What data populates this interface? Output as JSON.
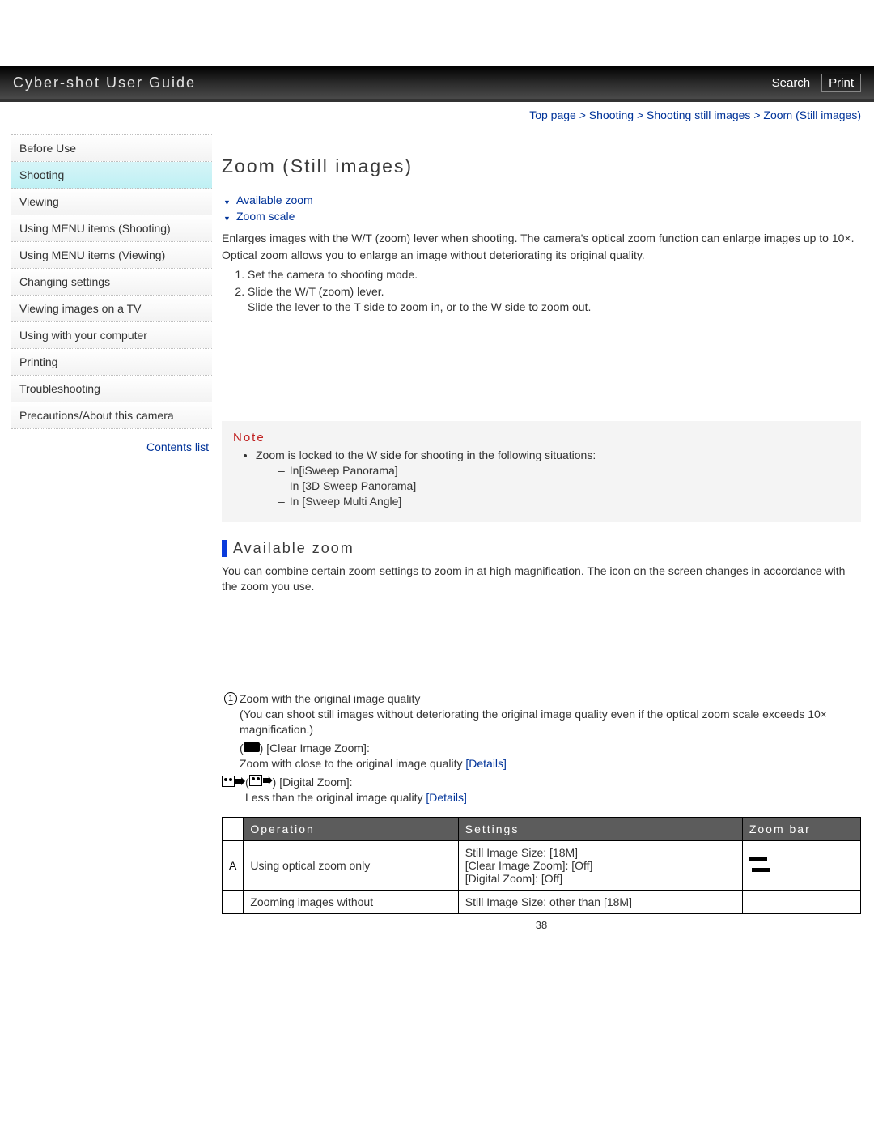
{
  "header": {
    "title": "Cyber-shot User Guide",
    "search_label": "Search",
    "print_label": "Print"
  },
  "breadcrumb": {
    "items": [
      "Top page",
      "Shooting",
      "Shooting still images",
      "Zoom (Still images)"
    ]
  },
  "sidebar": {
    "items": [
      {
        "label": "Before Use",
        "active": false
      },
      {
        "label": "Shooting",
        "active": true
      },
      {
        "label": "Viewing",
        "active": false
      },
      {
        "label": "Using MENU items (Shooting)",
        "active": false
      },
      {
        "label": "Using MENU items (Viewing)",
        "active": false
      },
      {
        "label": "Changing settings",
        "active": false
      },
      {
        "label": "Viewing images on a TV",
        "active": false
      },
      {
        "label": "Using with your computer",
        "active": false
      },
      {
        "label": "Printing",
        "active": false
      },
      {
        "label": "Troubleshooting",
        "active": false
      },
      {
        "label": "Precautions/About this camera",
        "active": false
      }
    ],
    "contents_list_label": "Contents list"
  },
  "page": {
    "title": "Zoom (Still images)",
    "anchor_links": [
      "Available zoom",
      "Zoom scale"
    ],
    "intro_paragraphs": [
      "Enlarges images with the W/T (zoom) lever when shooting. The camera's optical zoom function can enlarge images up to 10×.",
      "Optical zoom allows you to enlarge an image without deteriorating its original quality."
    ],
    "steps": [
      {
        "text": "Set the camera to shooting mode."
      },
      {
        "text": "Slide the W/T (zoom) lever.",
        "sub": "Slide the lever to the T side to zoom in, or to the W side to zoom out."
      }
    ],
    "note": {
      "heading": "Note",
      "lead": "Zoom is locked to the W side for shooting in the following situations:",
      "sub_items": [
        "In[iSweep Panorama]",
        "In [3D Sweep Panorama]",
        "In [Sweep Multi Angle]"
      ]
    },
    "available_zoom": {
      "heading": "Available zoom",
      "intro": "You can combine certain zoom settings to zoom in at high magnification. The icon on the screen changes in accordance with the zoom you use.",
      "items": [
        {
          "icon": "circled-one-icon",
          "title": "Zoom with the original image quality",
          "desc": "(You can shoot still images without deteriorating the original image quality even if the optical zoom scale exceeds 10× magnification.)"
        },
        {
          "icon": "rect-icon",
          "title": "[Clear Image Zoom]:",
          "prefix": "(",
          "suffix": ")",
          "desc": "Zoom with close to the original image quality ",
          "link": "[Details]"
        },
        {
          "icon": "digital-zoom-icon",
          "title": "[Digital Zoom]:",
          "prefix": "(",
          "suffix": ")",
          "desc": "Less than the original image quality ",
          "link": "[Details]"
        }
      ]
    },
    "table": {
      "headers": [
        "",
        "Operation",
        "Settings",
        "Zoom bar"
      ],
      "rows": [
        {
          "label": "A",
          "operation": "Using optical zoom only",
          "settings": "Still Image Size: [18M]\n[Clear Image Zoom]: [Off]\n[Digital Zoom]: [Off]",
          "zoombar": true
        },
        {
          "label": "",
          "operation": "Zooming images without",
          "settings": "Still Image Size: other than [18M]",
          "zoombar": false
        }
      ]
    },
    "page_number": "38"
  }
}
